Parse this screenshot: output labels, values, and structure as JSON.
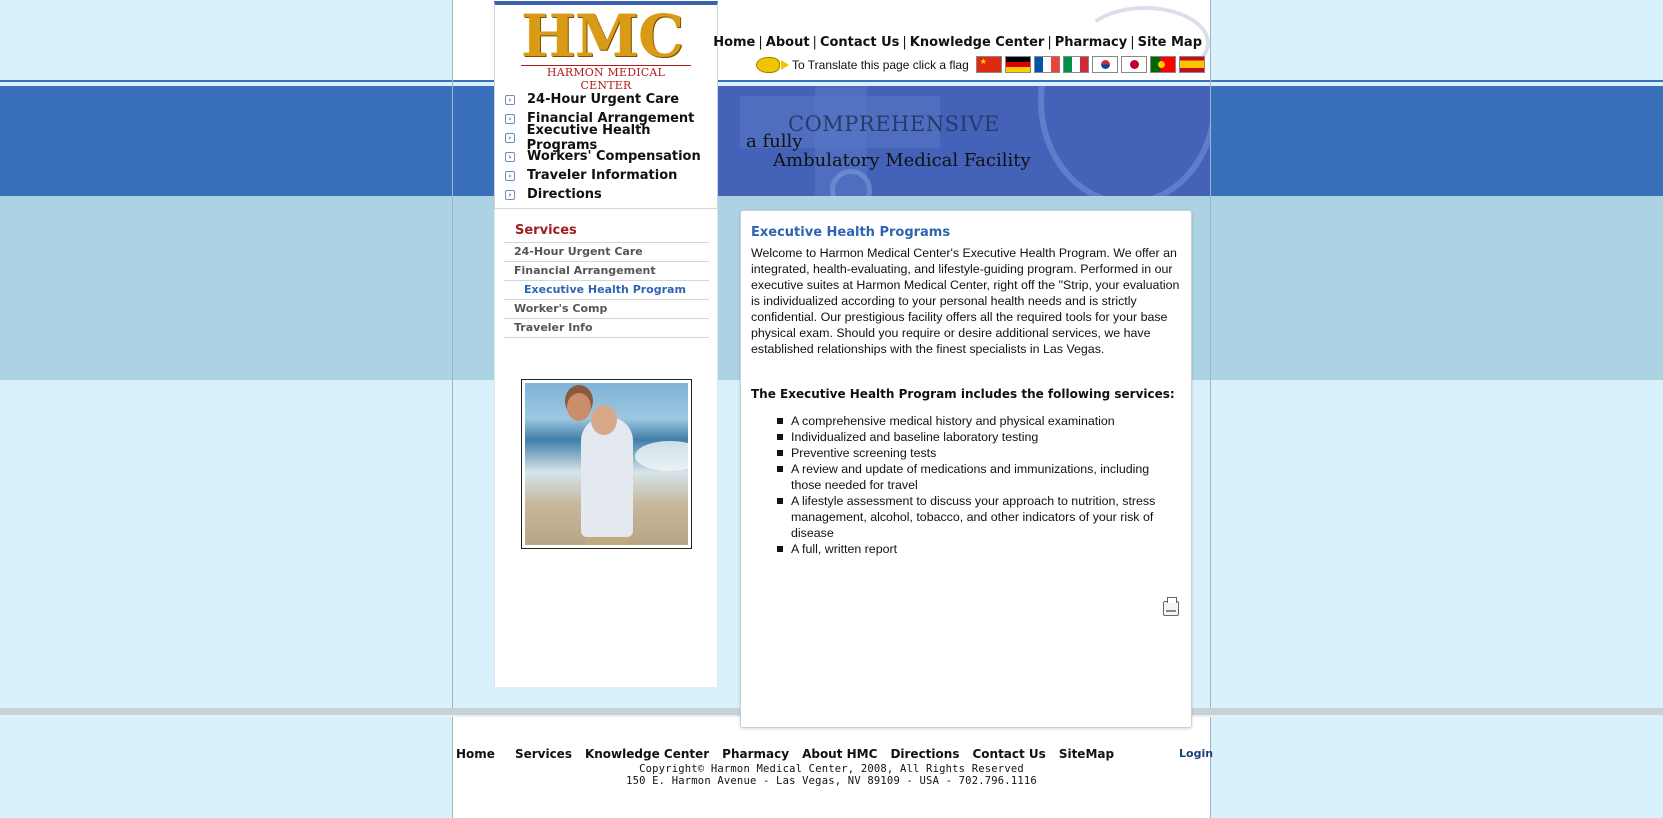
{
  "logo": {
    "text": "HMC",
    "subtitle": "HARMON MEDICAL CENTER"
  },
  "quick_nav": [
    "24-Hour Urgent Care",
    "Financial Arrangement",
    "Executive Health Programs",
    "Workers' Compensation",
    "Traveler Information",
    "Directions"
  ],
  "top_links": [
    "Home",
    "About",
    "Contact Us",
    "Knowledge Center",
    "Pharmacy",
    "Site Map"
  ],
  "translate": {
    "text": "To Translate this page click a flag",
    "flags": [
      "china-flag",
      "germany-flag",
      "france-flag",
      "italy-flag",
      "korea-flag",
      "japan-flag",
      "portugal-flag",
      "spain-flag"
    ]
  },
  "tagline": {
    "line1": "COMPREHENSIVE",
    "line2": "a fully",
    "line3": "Ambulatory Medical Facility"
  },
  "sidebar": {
    "title": "Services",
    "items": [
      {
        "label": "24-Hour Urgent Care",
        "active": false
      },
      {
        "label": "Financial Arrangement",
        "active": false
      },
      {
        "label": "Executive Health Program",
        "active": true
      },
      {
        "label": "Worker's Comp",
        "active": false
      },
      {
        "label": "Traveler Info",
        "active": false
      }
    ]
  },
  "content": {
    "title": "Executive Health Programs",
    "intro": "Welcome to Harmon Medical Center's Executive Health Program. We offer an integrated, health-evaluating, and lifestyle-guiding program. Performed in our executive suites at Harmon Medical Center, right off the \"Strip,  your evaluation is individualized according to your personal health needs and is strictly confidential. Our prestigious facility offers all the required tools for your base physical exam. Should you require or desire additional services, we have established relationships with the finest specialists in Las Vegas.",
    "services_heading": "The Executive Health Program includes the following services:",
    "services": [
      "A comprehensive medical history and physical examination",
      "Individualized and baseline laboratory testing",
      "Preventive screening tests",
      "A review and update of medications and immunizations, including those needed for travel",
      "A lifestyle assessment to discuss your approach to nutrition, stress management, alcohol, tobacco, and other indicators of your risk of disease",
      "A full, written report"
    ]
  },
  "footer": {
    "links": [
      "Home",
      "Services",
      "Knowledge Center",
      "Pharmacy",
      "About HMC",
      "Directions",
      "Contact Us",
      "SiteMap"
    ],
    "login": "Login",
    "copyright": "Copyright© Harmon Medical Center, 2008, All Rights Reserved",
    "address": "150 E. Harmon Avenue - Las Vegas, NV 89109 - USA - 702.796.1116"
  },
  "colors": {
    "accent_blue": "#2f64b0",
    "band_blue": "#396fba",
    "services_red": "#a31d1d",
    "logo_gold": "#d99a15"
  }
}
